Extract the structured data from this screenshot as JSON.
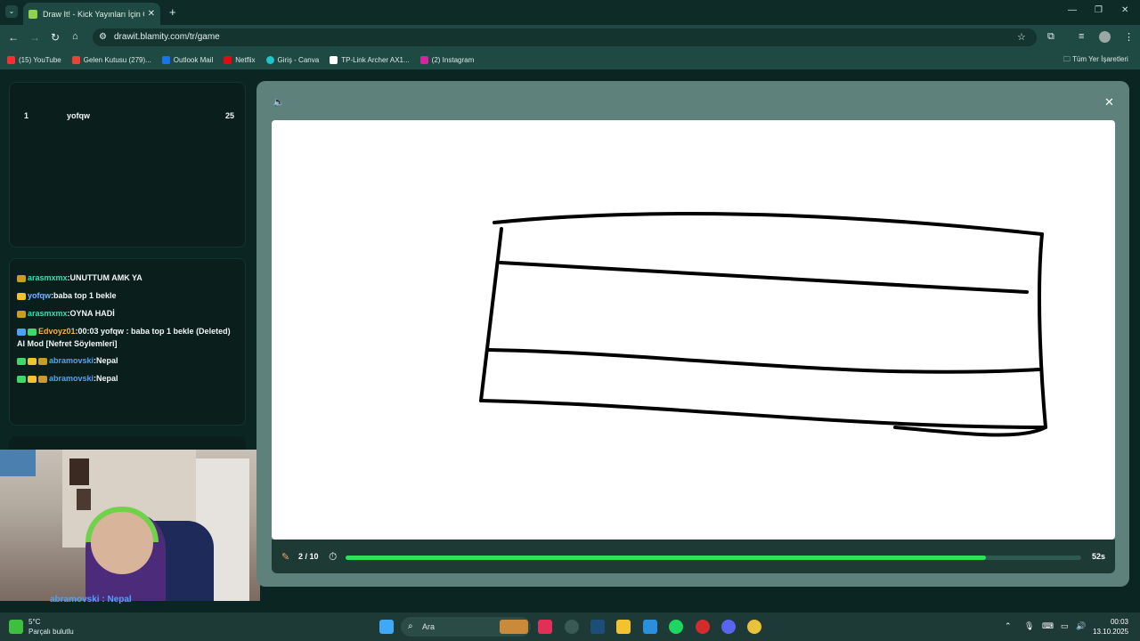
{
  "browser": {
    "tab_title": "Draw It! - Kick Yayınları İçin Çizim",
    "url": "drawit.blamity.com/tr/game",
    "bookmarks": [
      {
        "label": "(15) YouTube",
        "color": "#ff2d2d"
      },
      {
        "label": "Gelen Kutusu (279)...",
        "color": "#ea4335"
      },
      {
        "label": "Outlook Mail",
        "color": "#1a73e8"
      },
      {
        "label": "Netflix",
        "color": "#e50914"
      },
      {
        "label": "Giriş - Canva",
        "color": "#20c4cb"
      },
      {
        "label": "TP-Link Archer AX1...",
        "color": "#ffffff"
      },
      {
        "label": "(2) Instagram",
        "color": "#d6249f"
      }
    ],
    "all_bookmarks": "Tüm Yer İşaretleri"
  },
  "leaderboard": {
    "rank": "1",
    "name": "yofqw",
    "score": "25"
  },
  "chat": {
    "messages": [
      {
        "user": "arasmxmx",
        "text": ":UNUTTUM AMK YA"
      },
      {
        "user": "yofqw",
        "text": ":baba top 1 bekle"
      },
      {
        "user": "arasmxmx",
        "text": ":OYNA HADİ"
      },
      {
        "user": "Edvoyz01",
        "text": ":00:03 yofqw : baba top 1 bekle (Deleted) AI Mod [Nefret Söylemleri]"
      },
      {
        "user": "abramovski",
        "text": ":Nepal"
      },
      {
        "user": "abramovski",
        "text": ":Nepal"
      }
    ]
  },
  "overlay_text": "abramovski : Nepal",
  "game": {
    "round": "2 / 10",
    "seconds_left": "52s",
    "progress": 0.87
  },
  "taskbar": {
    "temp": "5°C",
    "weather": "Parçalı bulutlu",
    "search_placeholder": "Ara",
    "time": "00:03",
    "date": "13.10.2025"
  }
}
